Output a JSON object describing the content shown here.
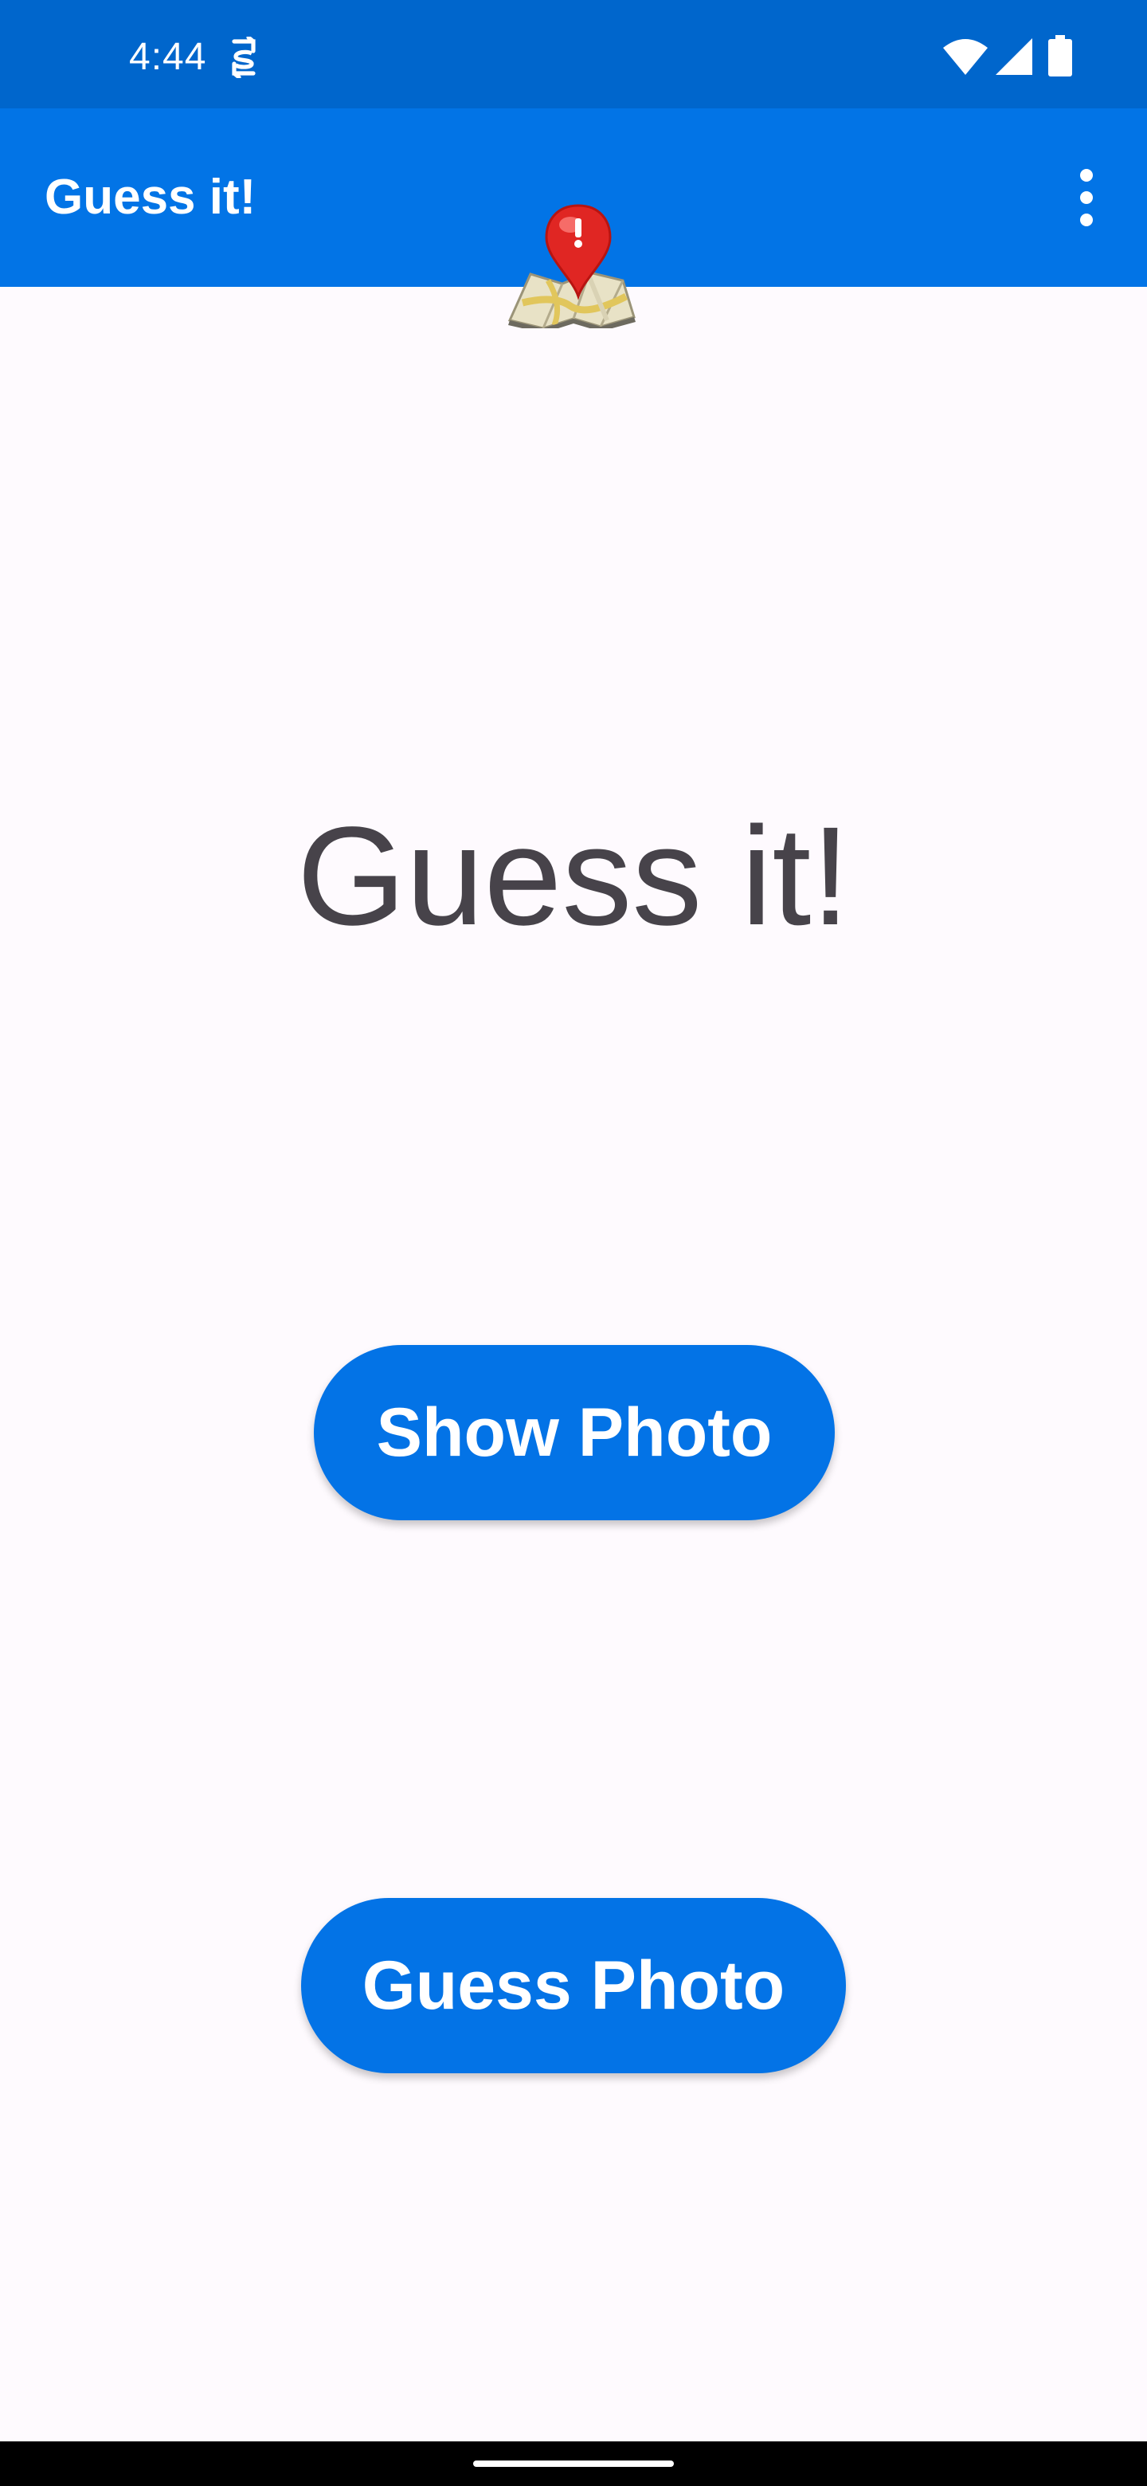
{
  "status_bar": {
    "time": "4:44",
    "icons": [
      "sim-sync-icon",
      "wifi-icon",
      "cell-signal-icon",
      "battery-icon"
    ]
  },
  "app_bar": {
    "title": "Guess it!",
    "overflow_icon": "more-vertical-icon"
  },
  "logo": {
    "icon": "map-pin-icon"
  },
  "main": {
    "title": "Guess it!",
    "show_photo_label": "Show Photo",
    "guess_photo_label": "Guess Photo"
  },
  "colors": {
    "status_bar": "#0066cc",
    "app_bar": "#0274e6",
    "button": "#0373e6",
    "title_text": "#47434a",
    "background": "#fefafe"
  }
}
